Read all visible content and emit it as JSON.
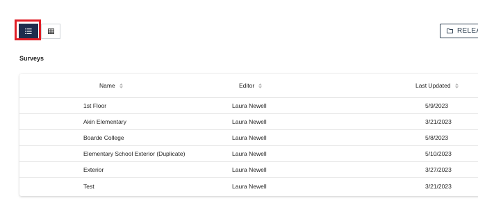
{
  "toolbar": {
    "view_list_icon": "list-icon",
    "view_grid_icon": "grid-icon",
    "release_label": "RELEA",
    "release_icon": "folder-icon"
  },
  "section": {
    "title": "Surveys"
  },
  "table": {
    "columns": [
      "Name",
      "Editor",
      "Last Updated"
    ],
    "rows": [
      {
        "name": "1st Floor",
        "editor": "Laura Newell",
        "updated": "5/9/2023"
      },
      {
        "name": "Akin Elementary",
        "editor": "Laura Newell",
        "updated": "3/21/2023"
      },
      {
        "name": "Boarde College",
        "editor": "Laura Newell",
        "updated": "5/8/2023"
      },
      {
        "name": "Elementary School Exterior (Duplicate)",
        "editor": "Laura Newell",
        "updated": "5/10/2023"
      },
      {
        "name": "Exterior",
        "editor": "Laura Newell",
        "updated": "3/27/2023"
      },
      {
        "name": "Test",
        "editor": "Laura Newell",
        "updated": "3/21/2023"
      }
    ]
  },
  "colors": {
    "accent": "#1f2d4d",
    "highlight": "#e01e26"
  }
}
